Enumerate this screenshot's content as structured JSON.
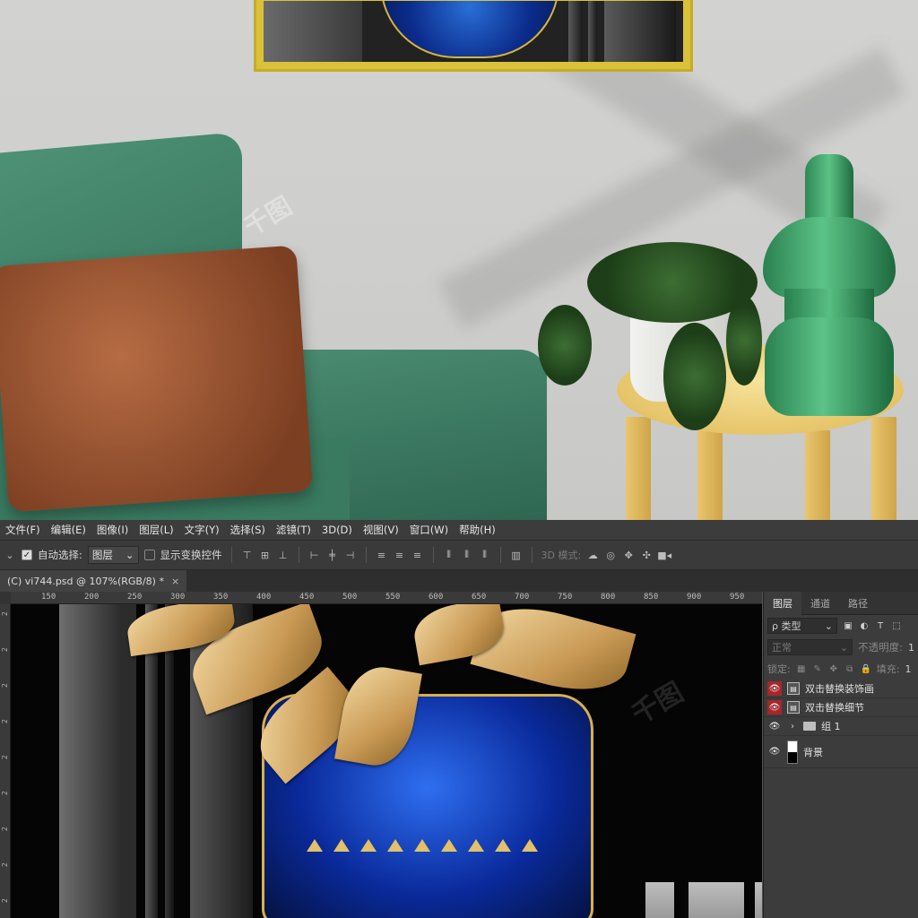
{
  "menubar": {
    "items": [
      "文件(F)",
      "编辑(E)",
      "图像(I)",
      "图层(L)",
      "文字(Y)",
      "选择(S)",
      "滤镜(T)",
      "3D(D)",
      "视图(V)",
      "窗口(W)",
      "帮助(H)"
    ]
  },
  "options_bar": {
    "auto_select_label": "自动选择:",
    "auto_select_checked": true,
    "auto_select_value": "图层",
    "show_transform_label": "显示变换控件",
    "show_transform_checked": false,
    "mode_3d_label": "3D 模式:"
  },
  "document_tab": {
    "title": "(C) vi744.psd @ 107%(RGB/8) *",
    "close_glyph": "×"
  },
  "ruler": {
    "h_labels": [
      "150",
      "200",
      "250",
      "300",
      "350",
      "400",
      "450",
      "500",
      "550",
      "600",
      "650",
      "700",
      "750",
      "800",
      "850",
      "900",
      "950"
    ],
    "v_labels": [
      "2",
      "2",
      "2",
      "2",
      "2",
      "2",
      "2",
      "2",
      "2"
    ]
  },
  "layers_panel": {
    "tabs": [
      "图层",
      "通道",
      "路径"
    ],
    "active_tab": "图层",
    "filter_label": "ρ 类型",
    "blend_mode": "正常",
    "opacity_label": "不透明度:",
    "opacity_value": "1",
    "lock_label": "锁定:",
    "fill_label": "填充:",
    "fill_value": "1",
    "layers": [
      {
        "name": "双击替换装饰画",
        "type": "smart",
        "visible": true,
        "eye_highlight": true
      },
      {
        "name": "双击替换细节",
        "type": "smart",
        "visible": true,
        "eye_highlight": true
      },
      {
        "name": "组 1",
        "type": "group",
        "visible": true,
        "eye_highlight": false
      },
      {
        "name": "背景",
        "type": "background",
        "visible": true,
        "eye_highlight": false
      }
    ]
  },
  "colors": {
    "menubar_bg": "#3c3c3c",
    "panel_bg": "#3c3c3c",
    "eye_highlight": "#a8262b",
    "frame_gold": "#d9c23a",
    "sofa_green": "#3f8467",
    "pillow_brown": "#9a5230",
    "vase_green": "#3aa36a",
    "canvas_blue": "#1a4fd0",
    "gold_leaf": "#d9b16b"
  },
  "icons": {
    "filter": "magnifier-icon",
    "eye": "eye-icon",
    "smart_object": "smart-object-icon",
    "folder": "folder-icon"
  }
}
